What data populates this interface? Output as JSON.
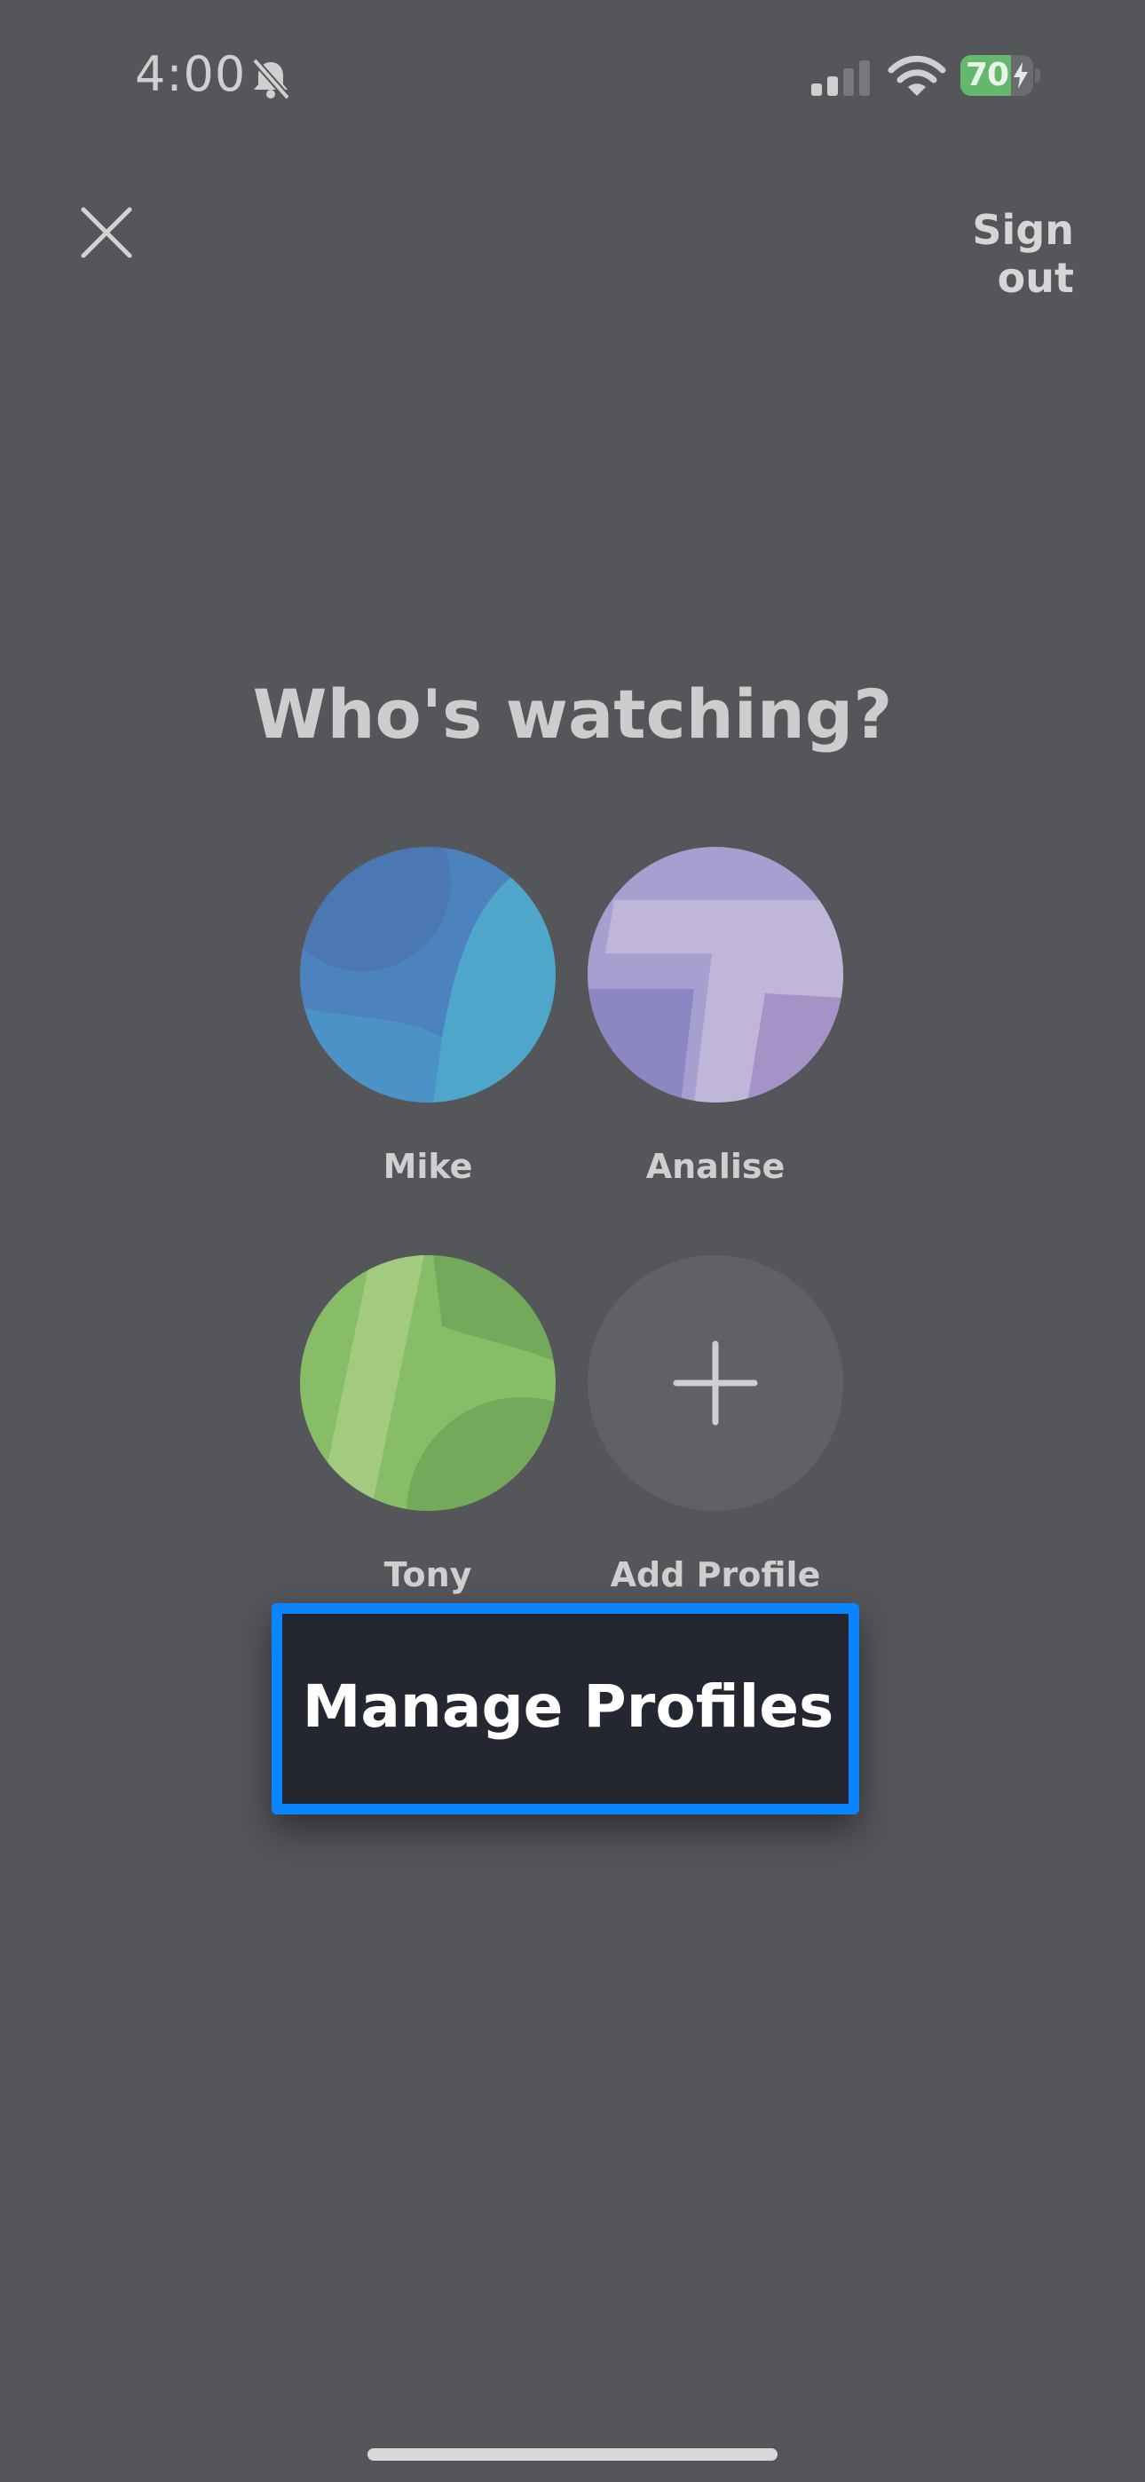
{
  "status_bar": {
    "time": "4:00",
    "battery": "70",
    "battery_fill_percent": 70,
    "icons": [
      "bell-slash-icon",
      "signal-icon",
      "wifi-icon",
      "battery-icon",
      "bolt-icon"
    ]
  },
  "header": {
    "close_icon": "close-icon",
    "sign_out_label": "Sign out"
  },
  "main": {
    "title": "Who's watching?",
    "profiles": [
      {
        "name": "Mike",
        "colors": [
          "#4a7fbd",
          "#4fa6c9"
        ]
      },
      {
        "name": "Analise",
        "colors": [
          "#9a97cf",
          "#c5acd3"
        ]
      },
      {
        "name": "Tony",
        "colors": [
          "#7fba64",
          "#a1cb7e"
        ]
      }
    ],
    "add_profile": {
      "label": "Add Profile",
      "icon": "plus-icon"
    }
  },
  "manage": {
    "label": "Manage Profiles",
    "highlight_color": "#0a84ff"
  }
}
